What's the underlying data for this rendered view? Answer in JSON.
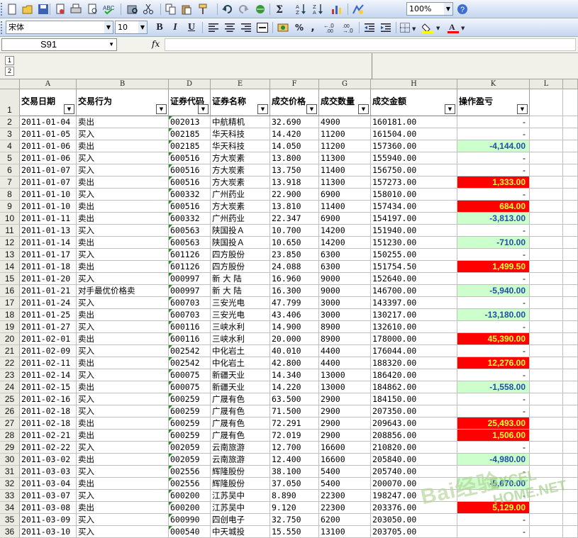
{
  "toolbar1": {
    "zoom": "100%",
    "icons": [
      "new-icon",
      "open-icon",
      "save-icon",
      "permission-icon",
      "print-icon",
      "print-preview-icon",
      "spelling-icon",
      "research-icon",
      "cut-icon",
      "copy-icon",
      "paste-icon",
      "format-painter-icon",
      "undo-icon",
      "redo-icon",
      "hyperlink-icon",
      "autosum-icon",
      "sort-ascending-icon",
      "sort-descending-icon",
      "chart-wizard-icon",
      "drawing-icon",
      "help-icon"
    ]
  },
  "toolbar2": {
    "font_name": "宋体",
    "font_size": "10",
    "bold": "B",
    "italic": "I",
    "underline": "U",
    "percent": "%",
    "comma": ","
  },
  "formula_bar": {
    "name_box": "S91",
    "fx": "fx",
    "content": ""
  },
  "outline": {
    "levels": [
      "1",
      "2"
    ]
  },
  "column_letters": [
    "A",
    "B",
    "D",
    "E",
    "F",
    "G",
    "H",
    "K",
    "L"
  ],
  "headers": {
    "row_number": "1",
    "cells": [
      "交易日期",
      "交易行为",
      "证券代码",
      "证券名称",
      "成交价格",
      "成交数量",
      "成交金额",
      "操作盈亏"
    ]
  },
  "rows": [
    {
      "n": "2",
      "date": "2011-01-04",
      "action": "卖出",
      "code": "002013",
      "name": "中航精机",
      "price": "32.690",
      "qty": "4900",
      "amount": "160181.00",
      "pl": "-",
      "pl_type": "none"
    },
    {
      "n": "3",
      "date": "2011-01-05",
      "action": "买入",
      "code": "002185",
      "name": "华天科技",
      "price": "14.420",
      "qty": "11200",
      "amount": "161504.00",
      "pl": "-",
      "pl_type": "none"
    },
    {
      "n": "4",
      "date": "2011-01-06",
      "action": "卖出",
      "code": "002185",
      "name": "华天科技",
      "price": "14.050",
      "qty": "11200",
      "amount": "157360.00",
      "pl": "-4,144.00",
      "pl_type": "neg"
    },
    {
      "n": "5",
      "date": "2011-01-06",
      "action": "买入",
      "code": "600516",
      "name": "方大炭素",
      "price": "13.800",
      "qty": "11300",
      "amount": "155940.00",
      "pl": "-",
      "pl_type": "none"
    },
    {
      "n": "6",
      "date": "2011-01-07",
      "action": "买入",
      "code": "600516",
      "name": "方大炭素",
      "price": "13.750",
      "qty": "11400",
      "amount": "156750.00",
      "pl": "-",
      "pl_type": "none"
    },
    {
      "n": "7",
      "date": "2011-01-07",
      "action": "卖出",
      "code": "600516",
      "name": "方大炭素",
      "price": "13.918",
      "qty": "11300",
      "amount": "157273.00",
      "pl": "1,333.00",
      "pl_type": "pos"
    },
    {
      "n": "8",
      "date": "2011-01-10",
      "action": "买入",
      "code": "600332",
      "name": "广州药业",
      "price": "22.900",
      "qty": "6900",
      "amount": "158010.00",
      "pl": "-",
      "pl_type": "none"
    },
    {
      "n": "9",
      "date": "2011-01-10",
      "action": "卖出",
      "code": "600516",
      "name": "方大炭素",
      "price": "13.810",
      "qty": "11400",
      "amount": "157434.00",
      "pl": "684.00",
      "pl_type": "pos"
    },
    {
      "n": "10",
      "date": "2011-01-11",
      "action": "卖出",
      "code": "600332",
      "name": "广州药业",
      "price": "22.347",
      "qty": "6900",
      "amount": "154197.00",
      "pl": "-3,813.00",
      "pl_type": "neg"
    },
    {
      "n": "11",
      "date": "2011-01-13",
      "action": "买入",
      "code": "600563",
      "name": "陕国投Ａ",
      "price": "10.700",
      "qty": "14200",
      "amount": "151940.00",
      "pl": "-",
      "pl_type": "none"
    },
    {
      "n": "12",
      "date": "2011-01-14",
      "action": "卖出",
      "code": "600563",
      "name": "陕国投Ａ",
      "price": "10.650",
      "qty": "14200",
      "amount": "151230.00",
      "pl": "-710.00",
      "pl_type": "neg"
    },
    {
      "n": "13",
      "date": "2011-01-17",
      "action": "买入",
      "code": "601126",
      "name": "四方股份",
      "price": "23.850",
      "qty": "6300",
      "amount": "150255.00",
      "pl": "-",
      "pl_type": "none"
    },
    {
      "n": "14",
      "date": "2011-01-18",
      "action": "卖出",
      "code": "601126",
      "name": "四方股份",
      "price": "24.088",
      "qty": "6300",
      "amount": "151754.50",
      "pl": "1,499.50",
      "pl_type": "pos"
    },
    {
      "n": "15",
      "date": "2011-01-20",
      "action": "买入",
      "code": "000997",
      "name": "新 大 陆",
      "price": "16.960",
      "qty": "9000",
      "amount": "152640.00",
      "pl": "-",
      "pl_type": "none"
    },
    {
      "n": "16",
      "date": "2011-01-21",
      "action": "对手最优价格卖",
      "code": "000997",
      "name": "新 大 陆",
      "price": "16.300",
      "qty": "9000",
      "amount": "146700.00",
      "pl": "-5,940.00",
      "pl_type": "neg"
    },
    {
      "n": "17",
      "date": "2011-01-24",
      "action": "买入",
      "code": "600703",
      "name": "三安光电",
      "price": "47.799",
      "qty": "3000",
      "amount": "143397.00",
      "pl": "-",
      "pl_type": "none"
    },
    {
      "n": "18",
      "date": "2011-01-25",
      "action": "卖出",
      "code": "600703",
      "name": "三安光电",
      "price": "43.406",
      "qty": "3000",
      "amount": "130217.00",
      "pl": "-13,180.00",
      "pl_type": "neg"
    },
    {
      "n": "19",
      "date": "2011-01-27",
      "action": "买入",
      "code": "600116",
      "name": "三峡水利",
      "price": "14.900",
      "qty": "8900",
      "amount": "132610.00",
      "pl": "-",
      "pl_type": "none"
    },
    {
      "n": "20",
      "date": "2011-02-01",
      "action": "卖出",
      "code": "600116",
      "name": "三峡水利",
      "price": "20.000",
      "qty": "8900",
      "amount": "178000.00",
      "pl": "45,390.00",
      "pl_type": "pos"
    },
    {
      "n": "21",
      "date": "2011-02-09",
      "action": "买入",
      "code": "002542",
      "name": "中化岩土",
      "price": "40.010",
      "qty": "4400",
      "amount": "176044.00",
      "pl": "-",
      "pl_type": "none"
    },
    {
      "n": "22",
      "date": "2011-02-11",
      "action": "卖出",
      "code": "002542",
      "name": "中化岩土",
      "price": "42.800",
      "qty": "4400",
      "amount": "188320.00",
      "pl": "12,276.00",
      "pl_type": "pos"
    },
    {
      "n": "23",
      "date": "2011-02-14",
      "action": "买入",
      "code": "600075",
      "name": "新疆天业",
      "price": "14.340",
      "qty": "13000",
      "amount": "186420.00",
      "pl": "-",
      "pl_type": "none"
    },
    {
      "n": "24",
      "date": "2011-02-15",
      "action": "卖出",
      "code": "600075",
      "name": "新疆天业",
      "price": "14.220",
      "qty": "13000",
      "amount": "184862.00",
      "pl": "-1,558.00",
      "pl_type": "neg"
    },
    {
      "n": "25",
      "date": "2011-02-16",
      "action": "买入",
      "code": "600259",
      "name": "广晟有色",
      "price": "63.500",
      "qty": "2900",
      "amount": "184150.00",
      "pl": "-",
      "pl_type": "none"
    },
    {
      "n": "26",
      "date": "2011-02-18",
      "action": "买入",
      "code": "600259",
      "name": "广晟有色",
      "price": "71.500",
      "qty": "2900",
      "amount": "207350.00",
      "pl": "-",
      "pl_type": "none"
    },
    {
      "n": "27",
      "date": "2011-02-18",
      "action": "卖出",
      "code": "600259",
      "name": "广晟有色",
      "price": "72.291",
      "qty": "2900",
      "amount": "209643.00",
      "pl": "25,493.00",
      "pl_type": "pos"
    },
    {
      "n": "28",
      "date": "2011-02-21",
      "action": "卖出",
      "code": "600259",
      "name": "广晟有色",
      "price": "72.019",
      "qty": "2900",
      "amount": "208856.00",
      "pl": "1,506.00",
      "pl_type": "pos"
    },
    {
      "n": "29",
      "date": "2011-02-22",
      "action": "买入",
      "code": "002059",
      "name": "云南旅游",
      "price": "12.700",
      "qty": "16600",
      "amount": "210820.00",
      "pl": "-",
      "pl_type": "none"
    },
    {
      "n": "30",
      "date": "2011-03-02",
      "action": "卖出",
      "code": "002059",
      "name": "云南旅游",
      "price": "12.400",
      "qty": "16600",
      "amount": "205840.00",
      "pl": "-4,980.00",
      "pl_type": "neg"
    },
    {
      "n": "31",
      "date": "2011-03-03",
      "action": "买入",
      "code": "002556",
      "name": "辉隆股份",
      "price": "38.100",
      "qty": "5400",
      "amount": "205740.00",
      "pl": "-",
      "pl_type": "none"
    },
    {
      "n": "32",
      "date": "2011-03-04",
      "action": "卖出",
      "code": "002556",
      "name": "辉隆股份",
      "price": "37.050",
      "qty": "5400",
      "amount": "200070.00",
      "pl": "-5,670.00",
      "pl_type": "neg"
    },
    {
      "n": "33",
      "date": "2011-03-07",
      "action": "买入",
      "code": "600200",
      "name": "江苏吴中",
      "price": "8.890",
      "qty": "22300",
      "amount": "198247.00",
      "pl": "-",
      "pl_type": "none"
    },
    {
      "n": "34",
      "date": "2011-03-08",
      "action": "卖出",
      "code": "600200",
      "name": "江苏吴中",
      "price": "9.120",
      "qty": "22300",
      "amount": "203376.00",
      "pl": "5,129.00",
      "pl_type": "pos"
    },
    {
      "n": "35",
      "date": "2011-03-09",
      "action": "买入",
      "code": "600990",
      "name": "四创电子",
      "price": "32.750",
      "qty": "6200",
      "amount": "203050.00",
      "pl": "-",
      "pl_type": "none"
    },
    {
      "n": "36",
      "date": "2011-03-10",
      "action": "买入",
      "code": "000540",
      "name": "中天城投",
      "price": "15.550",
      "qty": "13100",
      "amount": "203705.00",
      "pl": "-",
      "pl_type": "none"
    }
  ],
  "watermark": {
    "text1": "Bai经验",
    "text2": "EXCEL HOME.NET"
  },
  "colors": {
    "profit_fill": "#ff0000",
    "profit_text": "#ffff33",
    "loss_fill": "#ccffcc",
    "loss_text": "#1f4fa5"
  }
}
